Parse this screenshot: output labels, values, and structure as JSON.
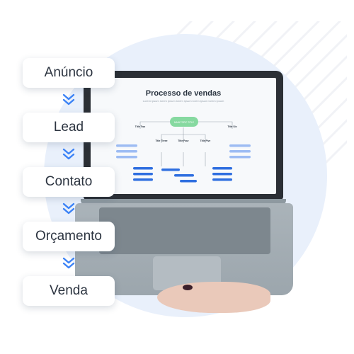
{
  "steps": [
    {
      "label": "Anúncio"
    },
    {
      "label": "Lead"
    },
    {
      "label": "Contato"
    },
    {
      "label": "Orçamento"
    },
    {
      "label": "Venda"
    }
  ],
  "slide": {
    "title": "Processo de vendas",
    "subtitle": "Lorem ipsum lorem ipsum lorem ipsum lorem ipsum lorem ipsum",
    "main_topic": "MAIN TOPIC TITLE",
    "subtopics": [
      "Title Two",
      "Title Three",
      "Title Four",
      "Title Five",
      "Title Six"
    ]
  },
  "colors": {
    "chevron": "#3b82f6",
    "green_node": "#86d9a0",
    "blue_node": "#2f6fe0",
    "light_blue_node": "#9dbcf3",
    "background_circle": "#e9f0fb"
  },
  "icons": {
    "step_separator": "double-chevron-down-icon"
  }
}
